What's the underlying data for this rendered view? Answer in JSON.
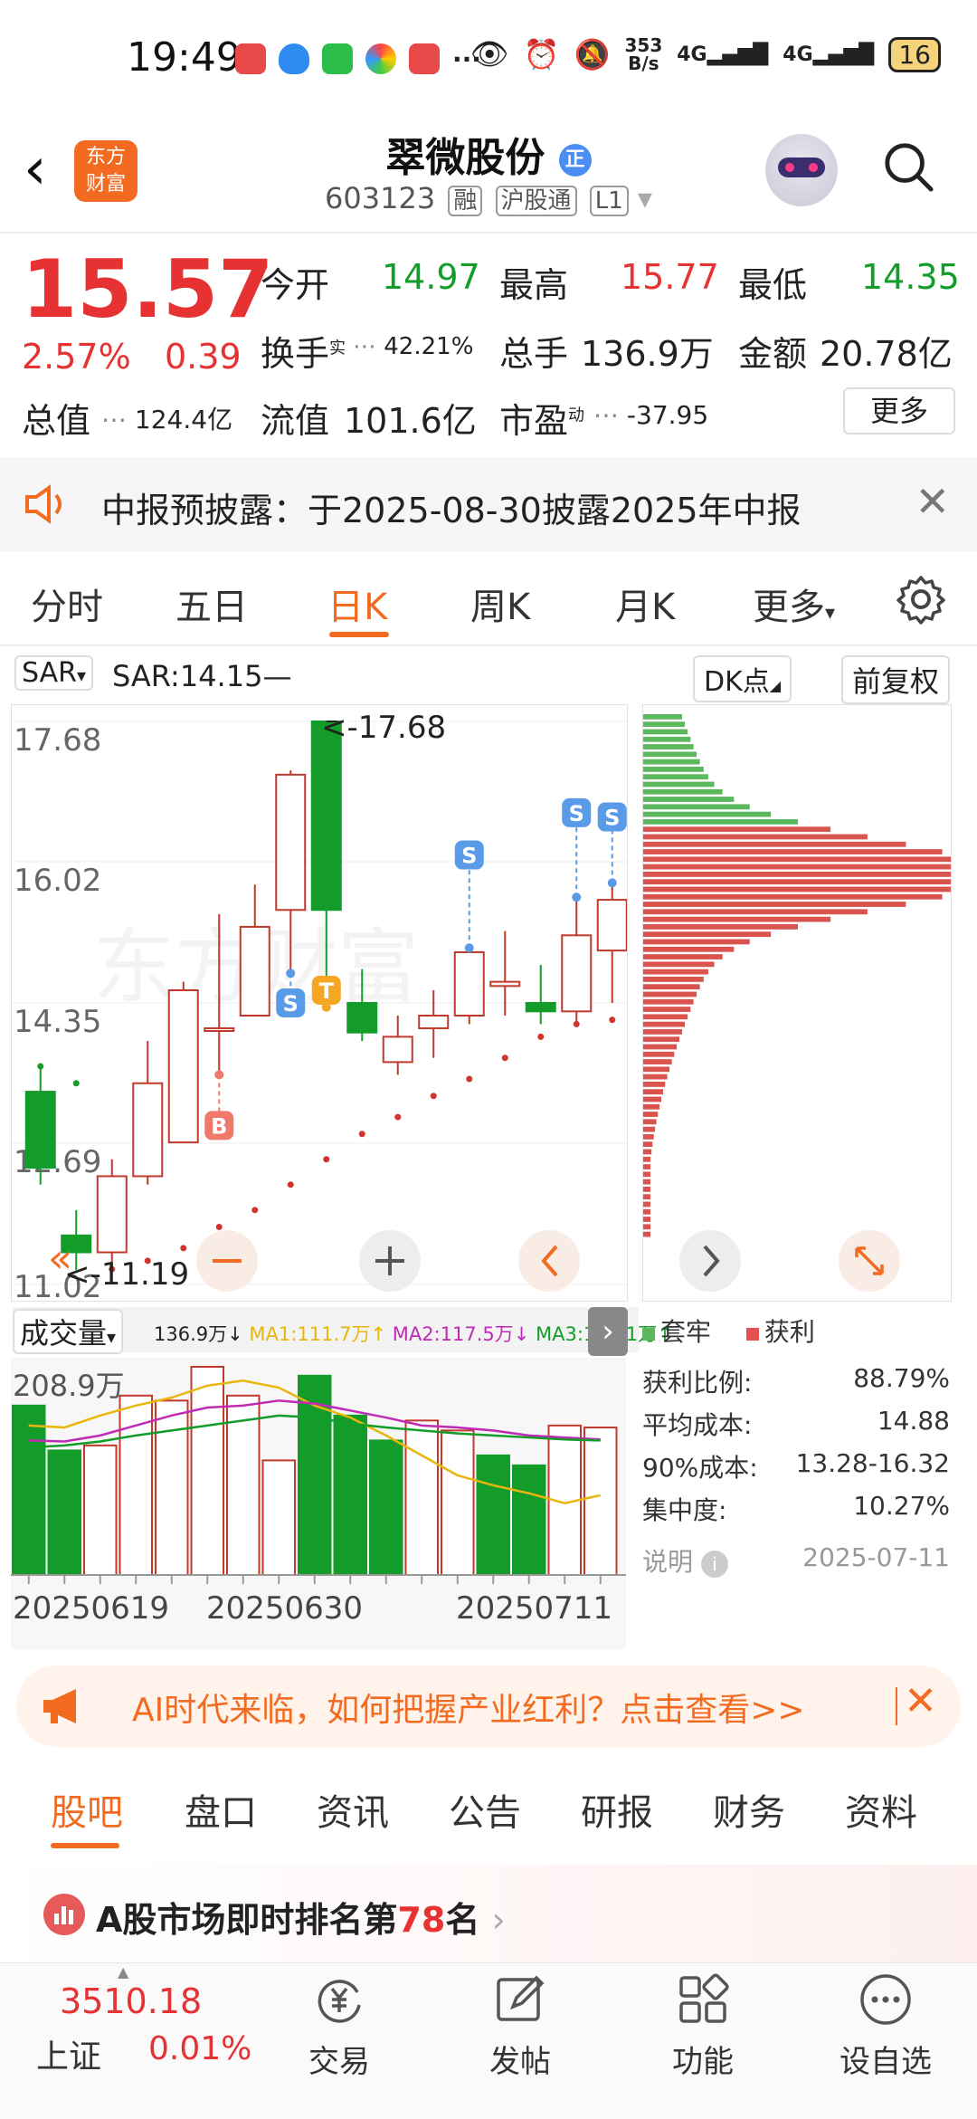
{
  "status_bar": {
    "time": "19:49",
    "net_speed_top": "353",
    "net_speed_bottom": "B/s",
    "signal1": "4G",
    "signal2": "4G",
    "battery": "16",
    "more_dots": "···"
  },
  "header": {
    "logo_line1": "东方",
    "logo_line2": "财富",
    "stock_name": "翠微股份",
    "badge": "正",
    "stock_code": "603123",
    "tags": [
      "融",
      "沪股通",
      "L1"
    ]
  },
  "quote": {
    "price": "15.57",
    "change_pct": "2.57%",
    "change": "0.39",
    "open_label": "今开",
    "open": "14.97",
    "high_label": "最高",
    "high": "15.77",
    "low_label": "最低",
    "low": "14.35",
    "turnover_label": "换手",
    "turnover_sup": "实",
    "turnover": "42.21%",
    "volume_label": "总手",
    "volume": "136.9万",
    "amount_label": "金额",
    "amount": "20.78亿",
    "mktcap_label": "总值",
    "mktcap": "124.4亿",
    "float_label": "流值",
    "float": "101.6亿",
    "pe_label": "市盈",
    "pe_sup": "动",
    "pe": "-37.95",
    "more_button": "更多"
  },
  "notice": {
    "text": "中报预披露：于2025-08-30披露2025年中报"
  },
  "tabs": [
    "分时",
    "五日",
    "日K",
    "周K",
    "月K",
    "更多"
  ],
  "active_tab": 2,
  "kline": {
    "indicator": "SAR",
    "sar_text": "SAR:14.15—",
    "dk_label": "DK点",
    "fq_label": "前复权",
    "y_ticks": [
      "17.68",
      "16.02",
      "14.35",
      "12.69",
      "11.02"
    ],
    "max_label": "<-17.68",
    "min_label": "<-11.19"
  },
  "volume": {
    "selector": "成交量",
    "vol": "136.9万↓",
    "ma1": "MA1:111.7万↑",
    "ma2": "MA2:117.5万↓",
    "ma3": "MA3:131.1万↑",
    "max_label": "208.9万",
    "dates": [
      "20250619",
      "20250630",
      "20250711"
    ]
  },
  "chip": {
    "legend_trapped": "套牢",
    "legend_profit": "获利",
    "rows": [
      {
        "label": "获利比例:",
        "value": "88.79%"
      },
      {
        "label": "平均成本:",
        "value": "14.88"
      },
      {
        "label": "90%成本:",
        "value": "13.28-16.32"
      },
      {
        "label": "集中度:",
        "value": "10.27%"
      }
    ],
    "note_label": "说明",
    "date": "2025-07-11"
  },
  "banner": {
    "text": "AI时代来临，如何把握产业红利？点击查看>>"
  },
  "bottom_tabs": [
    "股吧",
    "盘口",
    "资讯",
    "公告",
    "研报",
    "财务",
    "资料"
  ],
  "rank": {
    "prefix": "A股市场即时排名第",
    "rank": "78",
    "suffix": "名"
  },
  "navbar": {
    "index_value": "3510.18",
    "index_name": "上证",
    "index_change": "0.01%",
    "items": [
      "交易",
      "发帖",
      "功能",
      "设自选"
    ]
  },
  "colors": {
    "up": "#e63232",
    "down": "#139c2a",
    "accent": "#f26b21"
  },
  "chart_data": {
    "type": "candlestick",
    "candles": [
      {
        "o": 13.3,
        "c": 12.4,
        "h": 13.6,
        "l": 12.2
      },
      {
        "o": 11.6,
        "c": 11.4,
        "h": 11.9,
        "l": 11.19
      },
      {
        "o": 11.4,
        "c": 12.3,
        "h": 12.5,
        "l": 11.2
      },
      {
        "o": 12.3,
        "c": 13.4,
        "h": 13.9,
        "l": 12.2
      },
      {
        "o": 12.7,
        "c": 14.5,
        "h": 14.6,
        "l": 12.7
      },
      {
        "o": 14.05,
        "c": 14.05,
        "h": 15.4,
        "l": 13.5
      },
      {
        "o": 14.2,
        "c": 15.25,
        "h": 15.75,
        "l": 14.2
      },
      {
        "o": 15.45,
        "c": 17.05,
        "h": 17.1,
        "l": 14.7
      },
      {
        "o": 17.68,
        "c": 15.45,
        "h": 17.68,
        "l": 14.3
      },
      {
        "o": 14.35,
        "c": 14.0,
        "h": 14.75,
        "l": 13.9
      },
      {
        "o": 13.65,
        "c": 13.95,
        "h": 14.2,
        "l": 13.5
      },
      {
        "o": 14.05,
        "c": 14.2,
        "h": 14.5,
        "l": 13.7
      },
      {
        "o": 14.2,
        "c": 14.95,
        "h": 15.0,
        "l": 14.1
      },
      {
        "o": 14.55,
        "c": 14.6,
        "h": 15.2,
        "l": 14.2
      },
      {
        "o": 14.35,
        "c": 14.25,
        "h": 14.8,
        "l": 14.1
      },
      {
        "o": 14.25,
        "c": 15.15,
        "h": 15.6,
        "l": 14.1
      },
      {
        "o": 14.97,
        "c": 15.57,
        "h": 15.77,
        "l": 14.35
      }
    ],
    "sar_dots": [
      {
        "i": 0,
        "v": 13.6,
        "up": false
      },
      {
        "i": 1,
        "v": 13.4,
        "up": false
      },
      {
        "i": 2,
        "v": 11.2,
        "up": true
      },
      {
        "i": 3,
        "v": 11.3,
        "up": true
      },
      {
        "i": 4,
        "v": 11.45,
        "up": true
      },
      {
        "i": 5,
        "v": 11.7,
        "up": true
      },
      {
        "i": 6,
        "v": 11.9,
        "up": true
      },
      {
        "i": 7,
        "v": 12.2,
        "up": true
      },
      {
        "i": 8,
        "v": 12.5,
        "up": true
      },
      {
        "i": 9,
        "v": 12.8,
        "up": true
      },
      {
        "i": 10,
        "v": 13.0,
        "up": true
      },
      {
        "i": 11,
        "v": 13.25,
        "up": true
      },
      {
        "i": 12,
        "v": 13.45,
        "up": true
      },
      {
        "i": 13,
        "v": 13.7,
        "up": true
      },
      {
        "i": 14,
        "v": 13.95,
        "up": true
      },
      {
        "i": 15,
        "v": 14.1,
        "up": true
      },
      {
        "i": 16,
        "v": 14.15,
        "up": true
      }
    ],
    "signals": [
      {
        "i": 5,
        "label": "B",
        "v": 12.9
      },
      {
        "i": 7,
        "label": "S",
        "v": 14.35
      },
      {
        "i": 8,
        "label": "T",
        "v": 14.5
      },
      {
        "i": 12,
        "label": "S",
        "v": 16.1
      },
      {
        "i": 15,
        "label": "S",
        "v": 16.6
      },
      {
        "i": 16,
        "label": "S",
        "v": 16.55
      }
    ],
    "volumes": [
      {
        "v": 170,
        "up": false
      },
      {
        "v": 125,
        "up": false
      },
      {
        "v": 130,
        "up": true
      },
      {
        "v": 180,
        "up": true
      },
      {
        "v": 175,
        "up": true
      },
      {
        "v": 208.9,
        "up": true
      },
      {
        "v": 180,
        "up": true
      },
      {
        "v": 115,
        "up": true
      },
      {
        "v": 200,
        "up": false
      },
      {
        "v": 160,
        "up": false
      },
      {
        "v": 135,
        "up": false
      },
      {
        "v": 155,
        "up": true
      },
      {
        "v": 145,
        "up": true
      },
      {
        "v": 120,
        "up": false
      },
      {
        "v": 110,
        "up": false
      },
      {
        "v": 150,
        "up": true
      },
      {
        "v": 148,
        "up": true
      }
    ],
    "ylim": [
      11.02,
      17.68
    ],
    "chip_profit_share": 0.8879
  }
}
